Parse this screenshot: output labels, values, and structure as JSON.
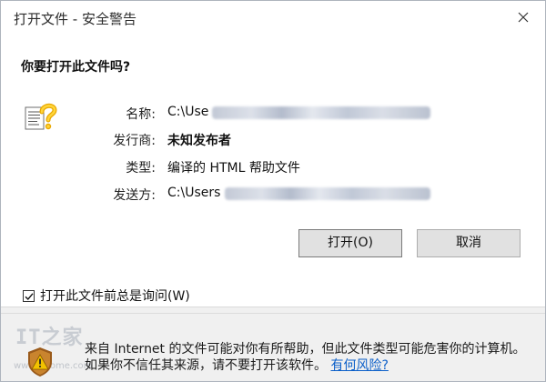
{
  "window": {
    "title": "打开文件 - 安全警告",
    "close_glyph": "✕"
  },
  "dialog": {
    "question": "你要打开此文件吗?",
    "fields": [
      {
        "label": "名称:",
        "value": "C:\\Use"
      },
      {
        "label": "发行商:",
        "value": "未知发布者"
      },
      {
        "label": "类型:",
        "value": "编译的 HTML 帮助文件"
      },
      {
        "label": "发送方:",
        "value": "C:\\Users"
      }
    ],
    "open_button": "打开(O)",
    "cancel_button": "取消",
    "always_ask_checkbox": {
      "label": "打开此文件前总是询问(W)",
      "checked": true
    }
  },
  "footer": {
    "watermark": "IT之家",
    "watermark_url": "www.ithome.com",
    "warning_text": "来自 Internet 的文件可能对你有所帮助，但此文件类型可能危害你的计算机。如果你不信任其来源，请不要打开该软件。",
    "risk_link": "有何风险?"
  },
  "colors": {
    "link": "#0b5fc9",
    "shield_yellow": "#f2c200",
    "shield_brown": "#9a5a1a",
    "window_bg": "#f0f0f0"
  },
  "icons": [
    "document-question-icon",
    "close-icon",
    "shield-warning-icon",
    "checkmark-icon"
  ]
}
